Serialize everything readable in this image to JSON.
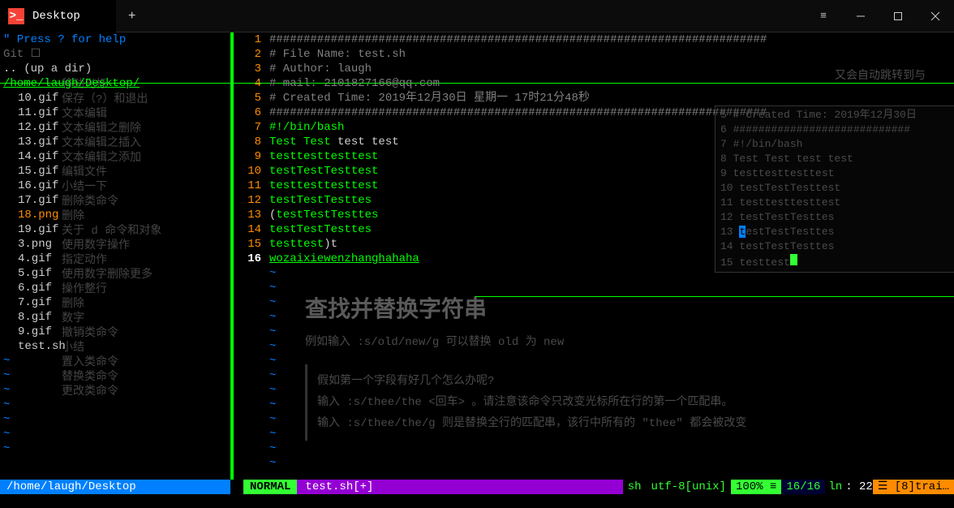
{
  "window": {
    "tab_label": "Desktop"
  },
  "tree": {
    "help": "\" Press ? for help",
    "git": "Git   ☐",
    "up": ".. (up a dir)",
    "path": "/home/laugh/Desktop/",
    "files": [
      "10.gif",
      "11.gif",
      "12.gif",
      "13.gif",
      "14.gif",
      "15.gif",
      "16.gif",
      "17.gif",
      "18.png",
      "19.gif",
      "3.png",
      "4.gif",
      "5.gif",
      "6.gif",
      "7.gif",
      "8.gif",
      "9.gif",
      "test.sh"
    ]
  },
  "editor": {
    "lines": [
      {
        "n": "1",
        "type": "comment",
        "text": "#########################################################################"
      },
      {
        "n": "2",
        "type": "comment",
        "text": "# File Name: test.sh"
      },
      {
        "n": "3",
        "type": "comment",
        "text": "# Author: laugh"
      },
      {
        "n": "4",
        "type": "comment",
        "text": "# mail: 2101827166@qq.com"
      },
      {
        "n": "5",
        "type": "comment",
        "text": "# Created Time: 2019年12月30日 星期一 17时21分48秒"
      },
      {
        "n": "6",
        "type": "comment",
        "text": "#########################################################################"
      },
      {
        "n": "7",
        "type": "shebang",
        "text": "#!/bin/bash"
      },
      {
        "n": "8",
        "type": "mixed",
        "parts": [
          {
            "c": "kw",
            "t": "Test Test"
          },
          {
            "c": "norm",
            "t": " test test"
          }
        ]
      },
      {
        "n": "9",
        "type": "kw",
        "text": "testtesttesttest"
      },
      {
        "n": "10",
        "type": "kw",
        "text": "testTestTesttest"
      },
      {
        "n": "11",
        "type": "kw",
        "text": "testtesttesttest"
      },
      {
        "n": "12",
        "type": "kw",
        "text": "testTestTesttes"
      },
      {
        "n": "13",
        "type": "mixed",
        "parts": [
          {
            "c": "norm",
            "t": "("
          },
          {
            "c": "kw",
            "t": "testTestTesttes"
          }
        ]
      },
      {
        "n": "14",
        "type": "kw",
        "text": "testTestTesttes"
      },
      {
        "n": "15",
        "type": "mixed",
        "parts": [
          {
            "c": "kw",
            "t": "testtest"
          },
          {
            "c": "norm",
            "t": ")t"
          }
        ]
      },
      {
        "n": "16",
        "type": "link",
        "text": "wozaixiewenzhanghahaha",
        "cur": true
      }
    ]
  },
  "status": {
    "path": "/home/laugh/Desktop",
    "mode": "NORMAL",
    "file": "test.sh[+]",
    "ft": "sh",
    "enc": "utf-8[unix]",
    "pct": "100% ≡",
    "pos": "16/16",
    "ln": "ln",
    "col": ": 22",
    "train": "☰ [8]trai…"
  },
  "bg_right": "又会自动跳转到与",
  "bgmenu": [
    "移动光标",
    "保存（?）和退出",
    "文本编辑",
    "文本编辑之删除",
    "文本编辑之插入",
    "文本编辑之添加",
    "编辑文件",
    "小结一下",
    "删除类命令",
    "删除",
    "关于 d 命令和对象",
    "使用数字操作",
    "指定动作",
    "使用数字删除更多",
    "操作整行",
    "删除",
    "数字",
    "撤销类命令",
    "小结",
    "置入类命令",
    "替换类命令",
    "更改类命令"
  ],
  "ghost": {
    "lines": [
      "# Created Time: 2019年12月30日",
      "############################",
      "#!/bin/bash",
      "Test Test test test",
      "testtesttesttest",
      "testTestTesttest",
      "testtesttesttest",
      "testTestTesttes",
      "testTestTesttes",
      "testTestTesttes",
      "testtest"
    ],
    "hl_row": 8,
    "cur_row": 10
  },
  "article": {
    "heading": "查找并替换字符串",
    "p1": "例如输入 :s/old/new/g 可以替换 old 为 new",
    "box": [
      "假如第一个字段有好几个怎么办呢?",
      "输入 :s/thee/the <回车> 。请注意该命令只改变光标所在行的第一个匹配串。",
      "输入 :s/thee/the/g 则是替换全行的匹配串，该行中所有的 \"thee\" 都会被改变"
    ]
  }
}
